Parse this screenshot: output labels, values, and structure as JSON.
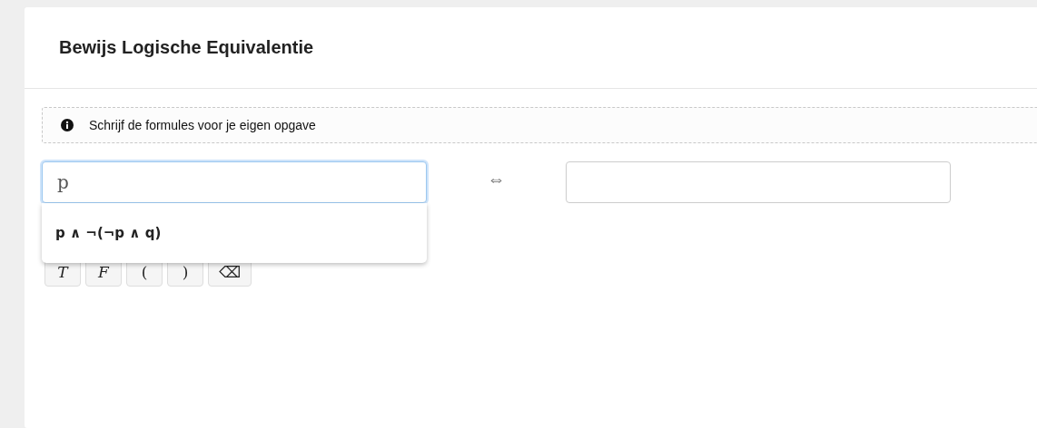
{
  "title": "Bewijs Logische Equivalentie",
  "info": "Schrijf de formules voor je eigen opgave",
  "left_field": {
    "value": "p",
    "focused": true
  },
  "equivalence_symbol": "⇔",
  "right_field": {
    "focused": false
  },
  "suggestions": [
    "p ∧ ¬(¬p ∧ q)"
  ],
  "keys": [
    {
      "label": "T",
      "kind": "italic"
    },
    {
      "label": "F",
      "kind": "italic"
    },
    {
      "label": "(",
      "kind": "plain"
    },
    {
      "label": ")",
      "kind": "plain"
    },
    {
      "label": "⌫",
      "kind": "symbol"
    }
  ]
}
